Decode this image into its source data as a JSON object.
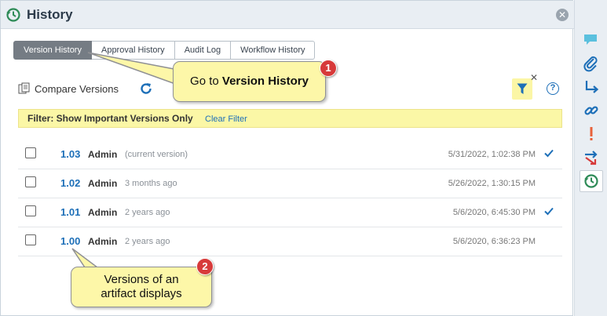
{
  "header": {
    "title": "History",
    "icon": "history-icon",
    "close_icon": "close-icon"
  },
  "tabs": [
    {
      "label": "Version History",
      "active": true
    },
    {
      "label": "Approval History",
      "active": false
    },
    {
      "label": "Audit Log",
      "active": false
    },
    {
      "label": "Workflow History",
      "active": false
    }
  ],
  "toolbar": {
    "compare_label": "Compare Versions",
    "refresh_icon": "refresh-icon",
    "filter_icon": "filter-icon",
    "help_icon": "help-icon"
  },
  "filter": {
    "label": "Filter:  Show Important Versions Only",
    "clear_label": "Clear Filter"
  },
  "versions": [
    {
      "version": "1.03",
      "user": "Admin",
      "note": "(current version)",
      "date": "5/31/2022, 1:02:38 PM",
      "checked": true
    },
    {
      "version": "1.02",
      "user": "Admin",
      "note": "3 months ago",
      "date": "5/26/2022, 1:30:15 PM",
      "checked": false
    },
    {
      "version": "1.01",
      "user": "Admin",
      "note": "2 years ago",
      "date": "5/6/2020, 6:45:30 PM",
      "checked": true
    },
    {
      "version": "1.00",
      "user": "Admin",
      "note": "2 years ago",
      "date": "5/6/2020, 6:36:23 PM",
      "checked": false
    }
  ],
  "callouts": [
    {
      "number": "1",
      "prefix": "Go to ",
      "bold": "Version History"
    },
    {
      "number": "2",
      "text_line1": "Versions of an",
      "text_line2": "artifact displays"
    }
  ],
  "sidebar_icons": [
    "discussion-icon",
    "attachment-icon",
    "relationship-arrow-icon",
    "link-icon",
    "alert-icon",
    "trace-icon",
    "history-icon"
  ],
  "colors": {
    "accent": "#1d6fb8",
    "filter_bg": "#fbf7a6",
    "active_tab": "#757c84",
    "badge": "#d73a3a",
    "history_green": "#2e8b57"
  }
}
